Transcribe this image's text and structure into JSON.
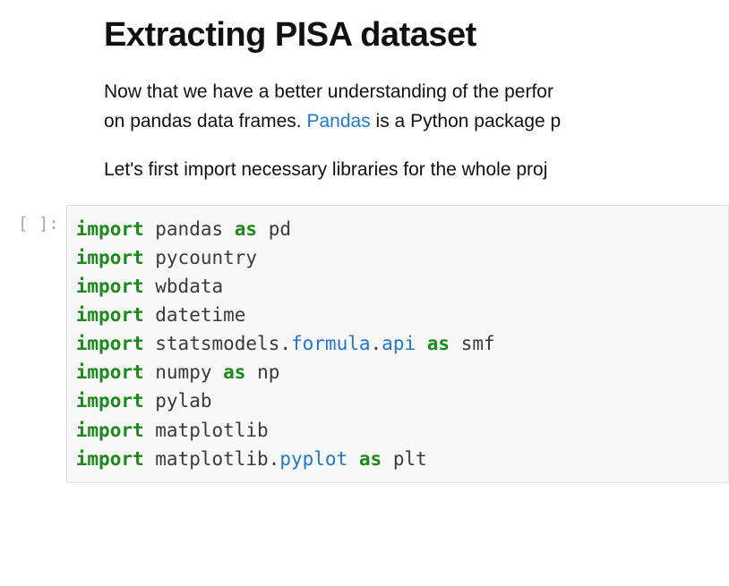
{
  "heading": "Extracting PISA dataset",
  "paragraph1_pre": "Now that we have a better understanding of the perfor",
  "paragraph1_line2_pre": "on pandas data frames. ",
  "paragraph1_link": "Pandas",
  "paragraph1_line2_post": " is a Python package p",
  "paragraph2": "Let's first import necessary libraries for the whole proj",
  "cell_prompt": "[ ]:",
  "code": {
    "lines": [
      [
        {
          "cls": "tok-kw",
          "t": "import"
        },
        {
          "cls": "tok-plain",
          "t": " pandas "
        },
        {
          "cls": "tok-kw",
          "t": "as"
        },
        {
          "cls": "tok-plain",
          "t": " pd"
        }
      ],
      [
        {
          "cls": "tok-kw",
          "t": "import"
        },
        {
          "cls": "tok-plain",
          "t": " pycountry"
        }
      ],
      [
        {
          "cls": "tok-kw",
          "t": "import"
        },
        {
          "cls": "tok-plain",
          "t": " wbdata"
        }
      ],
      [
        {
          "cls": "tok-kw",
          "t": "import"
        },
        {
          "cls": "tok-plain",
          "t": " datetime"
        }
      ],
      [
        {
          "cls": "tok-kw",
          "t": "import"
        },
        {
          "cls": "tok-plain",
          "t": " statsmodels"
        },
        {
          "cls": "tok-plain",
          "t": "."
        },
        {
          "cls": "tok-attr",
          "t": "formula"
        },
        {
          "cls": "tok-plain",
          "t": "."
        },
        {
          "cls": "tok-attr",
          "t": "api"
        },
        {
          "cls": "tok-plain",
          "t": " "
        },
        {
          "cls": "tok-kw",
          "t": "as"
        },
        {
          "cls": "tok-plain",
          "t": " smf"
        }
      ],
      [
        {
          "cls": "tok-kw",
          "t": "import"
        },
        {
          "cls": "tok-plain",
          "t": " numpy "
        },
        {
          "cls": "tok-kw",
          "t": "as"
        },
        {
          "cls": "tok-plain",
          "t": " np"
        }
      ],
      [
        {
          "cls": "tok-kw",
          "t": "import"
        },
        {
          "cls": "tok-plain",
          "t": " pylab"
        }
      ],
      [
        {
          "cls": "tok-kw",
          "t": "import"
        },
        {
          "cls": "tok-plain",
          "t": " matplotlib"
        }
      ],
      [
        {
          "cls": "tok-kw",
          "t": "import"
        },
        {
          "cls": "tok-plain",
          "t": " matplotlib"
        },
        {
          "cls": "tok-plain",
          "t": "."
        },
        {
          "cls": "tok-attr",
          "t": "pyplot"
        },
        {
          "cls": "tok-plain",
          "t": " "
        },
        {
          "cls": "tok-kw",
          "t": "as"
        },
        {
          "cls": "tok-plain",
          "t": " plt"
        }
      ]
    ]
  }
}
